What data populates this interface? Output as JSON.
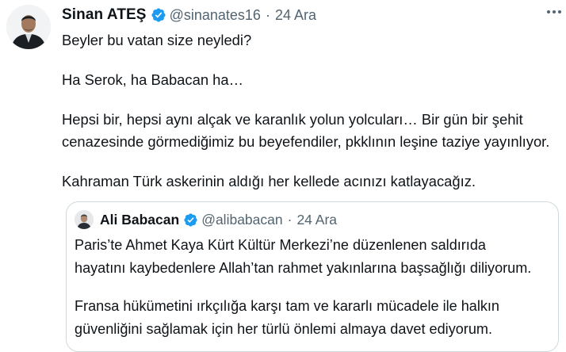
{
  "tweet": {
    "author": {
      "display_name": "Sinan ATEŞ",
      "handle": "@sinanates16",
      "verified_icon": "verified-badge-icon"
    },
    "separator": "·",
    "date": "24 Ara",
    "more_icon": "more-options-icon",
    "paragraphs": [
      "Beyler bu vatan size neyledi?",
      "Ha Serok, ha Babacan ha…",
      "Hepsi bir, hepsi aynı alçak ve karanlık yolun yolcuları… Bir gün bir şehit",
      "cenazesinde görmediğimiz bu beyefendiler, pkklının leşine taziye yayınlıyor.",
      "Kahraman Türk askerinin aldığı her kellede acınızı katlayacağız."
    ]
  },
  "quote": {
    "author": {
      "display_name": "Ali Babacan",
      "handle": "@alibabacan",
      "verified_icon": "verified-badge-icon"
    },
    "separator": "·",
    "date": "24 Ara",
    "lines": [
      "Paris’te Ahmet Kaya Kürt Kültür Merkezi’ne düzenlenen saldırıda",
      "hayatını kaybedenlere Allah’tan rahmet yakınlarına başsağlığı diliyorum.",
      "Fransa hükümetini ırkçılığa karşı tam ve kararlı mücadele ile halkın",
      "güvenliğini sağlamak için her türlü önlemi almaya davet ediyorum."
    ]
  },
  "colors": {
    "text_primary": "#0f1419",
    "text_secondary": "#536471",
    "verified_blue": "#1d9bf0",
    "border": "#cfd9de"
  }
}
